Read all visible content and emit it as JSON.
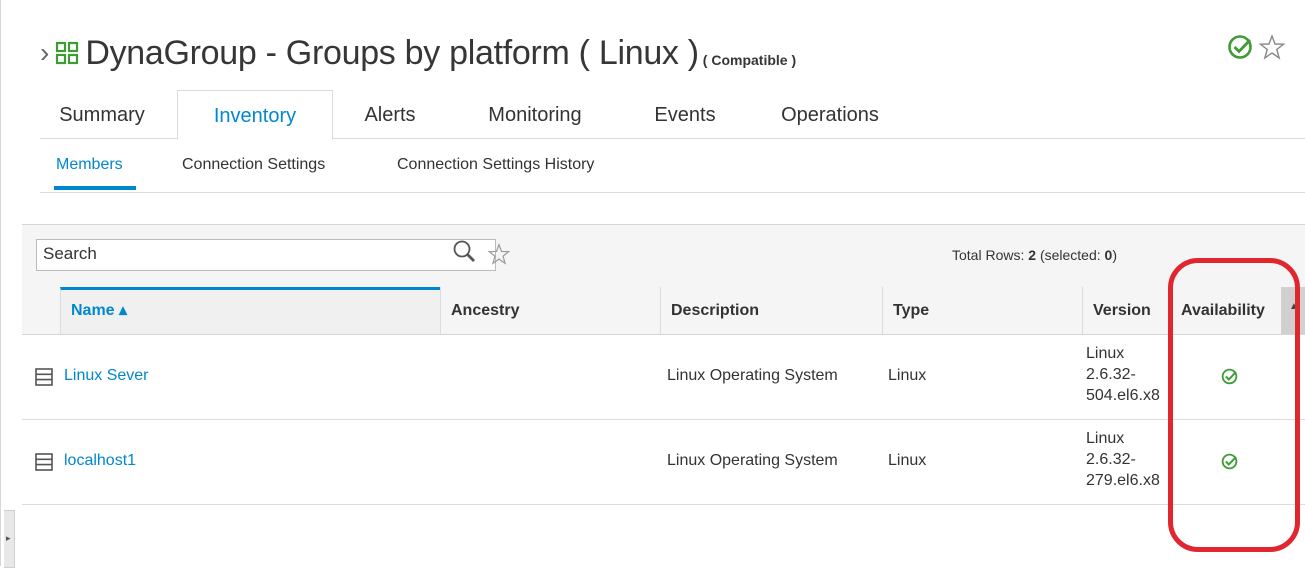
{
  "header": {
    "title": "DynaGroup - Groups by platform ( Linux )",
    "compat": "( Compatible )"
  },
  "main_tabs": [
    {
      "label": "Summary",
      "active": false
    },
    {
      "label": "Inventory",
      "active": true
    },
    {
      "label": "Alerts",
      "active": false
    },
    {
      "label": "Monitoring",
      "active": false
    },
    {
      "label": "Events",
      "active": false
    },
    {
      "label": "Operations",
      "active": false
    }
  ],
  "sub_tabs": [
    {
      "label": "Members",
      "active": true
    },
    {
      "label": "Connection Settings",
      "active": false
    },
    {
      "label": "Connection Settings History",
      "active": false
    }
  ],
  "search": {
    "placeholder": "Search"
  },
  "total_rows": {
    "label": "Total Rows:",
    "count": "2",
    "selected_label": "(selected:",
    "selected": "0",
    "close": ")"
  },
  "columns": {
    "name": "Name ▴",
    "ancestry": "Ancestry",
    "description": "Description",
    "type": "Type",
    "version": "Version",
    "availability": "Availability"
  },
  "rows": [
    {
      "name": "Linux Sever",
      "ancestry": "",
      "description": "Linux Operating System",
      "type": "Linux",
      "version_lines": [
        "Linux",
        "2.6.32-",
        "504.el6.x8"
      ],
      "availability": "up"
    },
    {
      "name": "localhost1",
      "ancestry": "",
      "description": "Linux Operating System",
      "type": "Linux",
      "version_lines": [
        "Linux",
        "2.6.32-",
        "279.el6.x8"
      ],
      "availability": "up"
    }
  ],
  "colors": {
    "accent": "#0088ce",
    "available": "#3f9c35",
    "highlight": "#e0262e"
  }
}
